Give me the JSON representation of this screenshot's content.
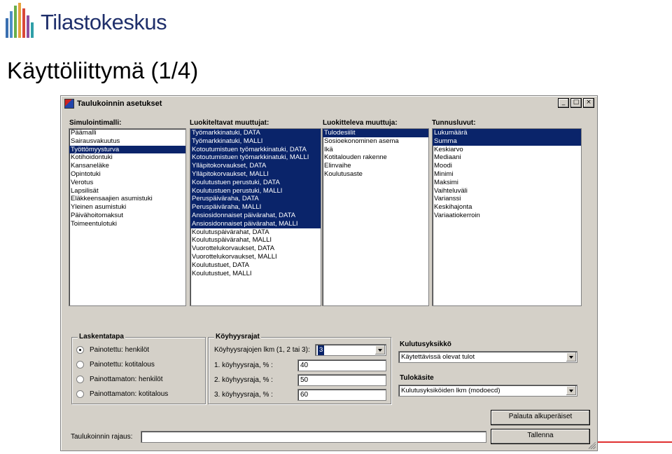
{
  "brand": {
    "name": "Tilastokeskus"
  },
  "slide": {
    "title": "Käyttöliittymä (1/4)"
  },
  "window": {
    "title": "Taulukoinnin asetukset",
    "controls": {
      "minimize": "_",
      "maximize": "□",
      "close": "×"
    }
  },
  "lists": {
    "simulointimalli": {
      "label": "Simulointimalli:",
      "items": [
        "Päämalli",
        "Sairausvakuutus",
        "Työttömyysturva",
        "Kotihoidontuki",
        "Kansaneläke",
        "Opintotuki",
        "Verotus",
        "Lapsilisät",
        "Eläkkeensaajien asumistuki",
        "Yleinen asumistuki",
        "Päivähoitomaksut",
        "Toimeentulotuki"
      ],
      "selected": [
        2
      ]
    },
    "luokiteltavat": {
      "label": "Luokiteltavat muuttujat:",
      "items": [
        "Työmarkkinatuki, DATA",
        "Työmarkkinatuki, MALLI",
        "Kotoutumistuen työmarkkinatuki, DATA",
        "Kotoutumistuen työmarkkinatuki, MALLI",
        "Ylläpitokorvaukset, DATA",
        "Ylläpitokorvaukset, MALLI",
        "Koulutustuen perustuki, DATA",
        "Koulutustuen perustuki, MALLI",
        "Peruspäiväraha, DATA",
        "Peruspäiväraha, MALLI",
        "Ansiosidonnaiset päivärahat, DATA",
        "Ansiosidonnaiset päivärahat, MALLI",
        "Koulutuspäivärahat, DATA",
        "Koulutuspäivärahat, MALLI",
        "Vuorottelukorvaukset, DATA",
        "Vuorottelukorvaukset, MALLI",
        "Koulutustuet, DATA",
        "Koulutustuet, MALLI"
      ],
      "selected": [
        0,
        1,
        2,
        3,
        4,
        5,
        6,
        7,
        8,
        9,
        10,
        11
      ]
    },
    "luokitteleva": {
      "label": "Luokitteleva muuttuja:",
      "items": [
        "Tulodesiilit",
        "Sosioekonominen asema",
        "Ikä",
        "Kotitalouden rakenne",
        "Elinvaihe",
        "Koulutusaste"
      ],
      "selected": [
        0
      ]
    },
    "tunnusluvut": {
      "label": "Tunnusluvut:",
      "items": [
        "Lukumäärä",
        "Summa",
        "Keskiarvo",
        "Mediaani",
        "Moodi",
        "Minimi",
        "Maksimi",
        "Vaihteluväli",
        "Varianssi",
        "Keskihajonta",
        "Variaatiokerroin"
      ],
      "selected": [
        0,
        1
      ]
    }
  },
  "laskentatapa": {
    "label": "Laskentatapa",
    "options": [
      "Painotettu: henkilöt",
      "Painotettu: kotitalous",
      "Painottamaton: henkilöt",
      "Painottamaton: kotitalous"
    ],
    "selected": 0
  },
  "koyhyysrajat": {
    "label": "Köyhyysrajat",
    "count_label": "Köyhyysrajojen lkm (1, 2 tai 3):",
    "count_value": "3",
    "rows": [
      {
        "label": "1. köyhyysraja, % :",
        "value": "40"
      },
      {
        "label": "2. köyhyysraja, % :",
        "value": "50"
      },
      {
        "label": "3. köyhyysraja, % :",
        "value": "60"
      }
    ]
  },
  "kulutusyksikko": {
    "label": "Kulutusyksikkö",
    "value": "Käytettävissä olevat tulot"
  },
  "tulokasite": {
    "label": "Tulokäsite",
    "value": "Kulutusyksiköiden lkm (modoecd)"
  },
  "rajaus": {
    "label": "Taulukoinnin rajaus:",
    "value": ""
  },
  "buttons": {
    "reset": "Palauta alkuperäiset",
    "save": "Tallenna"
  },
  "colors": {
    "selection": "#0a246a",
    "window_bg": "#d4d0c8",
    "brand_text": "#1f2f6b",
    "accent_line": "#e03030"
  }
}
